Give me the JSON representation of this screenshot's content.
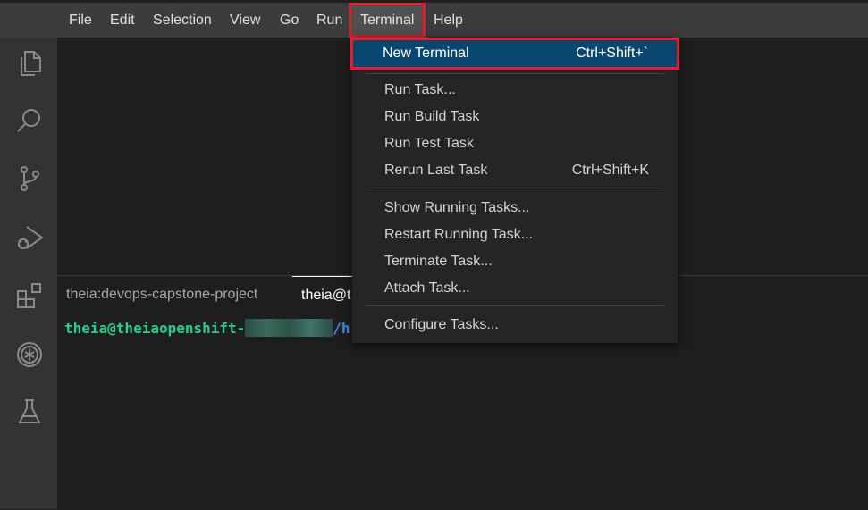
{
  "menubar": {
    "items": [
      "File",
      "Edit",
      "Selection",
      "View",
      "Go",
      "Run",
      "Terminal",
      "Help"
    ],
    "active": "Terminal"
  },
  "activity_bar": {
    "icons": [
      "files-icon",
      "search-icon",
      "source-control-icon",
      "run-debug-icon",
      "extensions-icon",
      "openshift-icon",
      "testing-icon"
    ]
  },
  "terminal_menu": {
    "groups": [
      [
        {
          "label": "New Terminal",
          "shortcut": "Ctrl+Shift+`",
          "highlighted": true
        }
      ],
      [
        {
          "label": "Run Task...",
          "shortcut": ""
        },
        {
          "label": "Run Build Task",
          "shortcut": ""
        },
        {
          "label": "Run Test Task",
          "shortcut": ""
        },
        {
          "label": "Rerun Last Task",
          "shortcut": "Ctrl+Shift+K"
        }
      ],
      [
        {
          "label": "Show Running Tasks...",
          "shortcut": ""
        },
        {
          "label": "Restart Running Task...",
          "shortcut": ""
        },
        {
          "label": "Terminate Task...",
          "shortcut": ""
        },
        {
          "label": "Attach Task...",
          "shortcut": ""
        }
      ],
      [
        {
          "label": "Configure Tasks...",
          "shortcut": ""
        }
      ]
    ]
  },
  "panel": {
    "tabs": [
      {
        "label": "theia:devops-capstone-project",
        "active": false
      },
      {
        "label": "theia@t",
        "active": true
      }
    ],
    "terminal": {
      "prompt_user": "theia@theiaopenshift-",
      "prompt_path": "/h"
    }
  },
  "colors": {
    "highlight_outline": "#e02030",
    "menu_selection": "#094771",
    "prompt_green": "#23d18b",
    "prompt_blue": "#3b8eea"
  }
}
